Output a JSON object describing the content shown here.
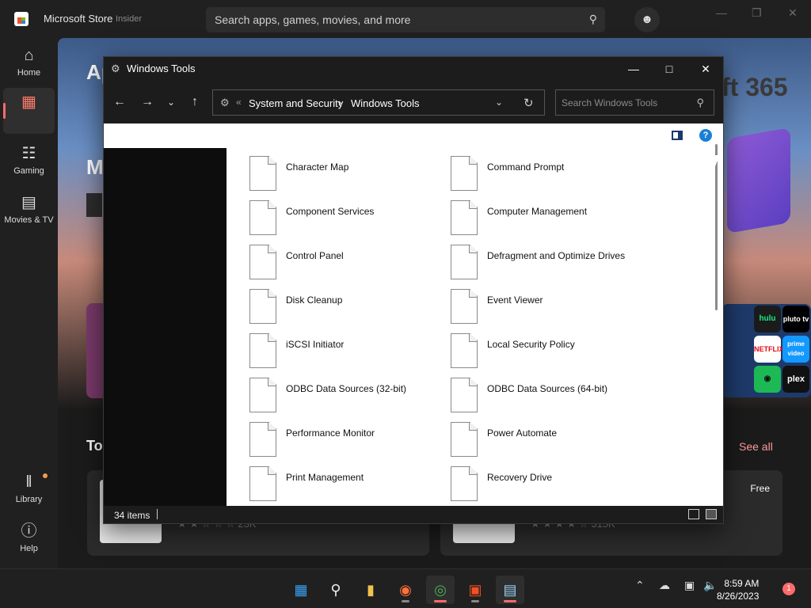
{
  "store": {
    "title": "Microsoft Store",
    "channel": "Insider",
    "search_placeholder": "Search apps, games, movies, and more",
    "nav": [
      {
        "label": "Home",
        "icon": "home-icon"
      },
      {
        "label": "Apps",
        "icon": "apps-icon"
      },
      {
        "label": "Gaming",
        "icon": "gamepad-icon"
      },
      {
        "label": "Movies & TV",
        "icon": "clapper-icon"
      },
      {
        "label": "Library",
        "icon": "library-icon"
      },
      {
        "label": "Help",
        "icon": "help-icon"
      }
    ],
    "hero_line1": "Ap",
    "hero_line2": "M",
    "hero_brand": "ft 365",
    "section_title": "To",
    "see_all": "See all",
    "card1_reviews": "23K",
    "card2_reviews": "315K",
    "card2_price": "Free",
    "streaming_tiles": [
      "hulu",
      "pluto tv",
      "NETFLIX",
      "prime video",
      "plex"
    ]
  },
  "explorer": {
    "title": "Windows Tools",
    "breadcrumb": [
      "System and Security",
      "Windows Tools"
    ],
    "search_placeholder": "Search Windows Tools",
    "items_col1": [
      "Character Map",
      "Component Services",
      "Control Panel",
      "Disk Cleanup",
      "iSCSI Initiator",
      "ODBC Data Sources (32-bit)",
      "Performance Monitor",
      "Print Management"
    ],
    "items_col2": [
      "Command Prompt",
      "Computer Management",
      "Defragment and Optimize Drives",
      "Event Viewer",
      "Local Security Policy",
      "ODBC Data Sources (64-bit)",
      "Power Automate",
      "Recovery Drive"
    ],
    "status": "34 items"
  },
  "taskbar": {
    "apps": [
      "start-icon",
      "search-icon",
      "file-explorer-icon",
      "firefox-icon",
      "chrome-icon",
      "store-icon",
      "windows-tools-icon"
    ],
    "time": "8:59 AM",
    "date": "8/26/2023",
    "notifications": "1"
  },
  "colors": {
    "accent": "#ff6b6b",
    "chrome_dark": "#1c1c1c",
    "help_blue": "#1a7fd6"
  }
}
